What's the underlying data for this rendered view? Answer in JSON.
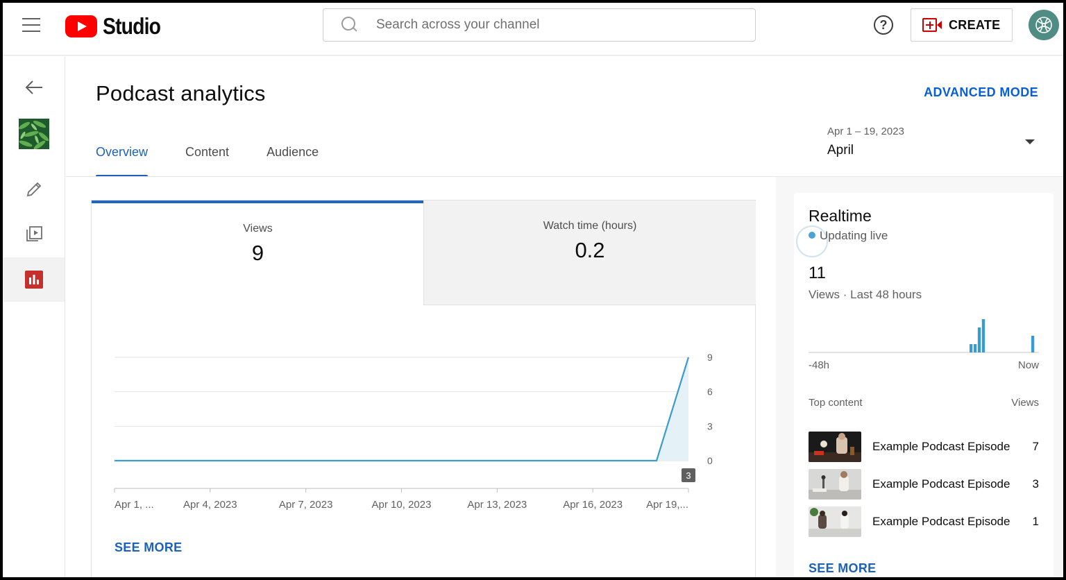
{
  "topbar": {
    "logo_text": "Studio",
    "search_placeholder": "Search across your channel",
    "help_glyph": "?",
    "create_label": "CREATE"
  },
  "icons": {
    "menu": "hamburger-menu-icon",
    "search": "search-icon",
    "help": "help-icon",
    "create": "video-camera-plus-icon",
    "back": "back-arrow-icon",
    "edit": "pencil-icon",
    "content": "video-library-icon",
    "analytics": "analytics-bar-chart-icon"
  },
  "page": {
    "title": "Podcast analytics",
    "advanced_mode": "ADVANCED MODE",
    "tabs": [
      {
        "label": "Overview",
        "active": true
      },
      {
        "label": "Content",
        "active": false
      },
      {
        "label": "Audience",
        "active": false
      }
    ],
    "date_range": "Apr 1 – 19, 2023",
    "date_label": "April"
  },
  "metrics": [
    {
      "label": "Views",
      "value": "9",
      "selected": true
    },
    {
      "label": "Watch time (hours)",
      "value": "0.2",
      "selected": false
    }
  ],
  "chart_data": {
    "type": "area",
    "x": [
      "Apr 1, 2023",
      "Apr 2, 2023",
      "Apr 3, 2023",
      "Apr 4, 2023",
      "Apr 5, 2023",
      "Apr 6, 2023",
      "Apr 7, 2023",
      "Apr 8, 2023",
      "Apr 9, 2023",
      "Apr 10, 2023",
      "Apr 11, 2023",
      "Apr 12, 2023",
      "Apr 13, 2023",
      "Apr 14, 2023",
      "Apr 15, 2023",
      "Apr 16, 2023",
      "Apr 17, 2023",
      "Apr 18, 2023",
      "Apr 19, 2023"
    ],
    "series": [
      {
        "values": [
          0,
          0,
          0,
          0,
          0,
          0,
          0,
          0,
          0,
          0,
          0,
          0,
          0,
          0,
          0,
          0,
          0,
          0,
          9
        ]
      }
    ],
    "x_tick_labels": [
      "Apr 1, ...",
      "Apr 4, 2023",
      "Apr 7, 2023",
      "Apr 10, 2023",
      "Apr 13, 2023",
      "Apr 16, 2023",
      "Apr 19,..."
    ],
    "y_ticks": [
      0,
      3,
      6,
      9
    ],
    "ylim": [
      0,
      9
    ],
    "grid": true,
    "marker_badge": "3",
    "color": "#3a9bd0"
  },
  "chart_see_more": "SEE MORE",
  "realtime": {
    "title": "Realtime",
    "status": "Updating live",
    "count": "11",
    "subtitle": "Views · Last 48 hours",
    "axis_start": "-48h",
    "axis_end": "Now",
    "bars_color": "#3a9bd0",
    "bars": [
      0,
      0,
      0,
      0,
      0,
      0,
      0,
      0,
      0,
      0,
      0,
      0,
      0,
      0,
      0,
      0,
      0,
      0,
      0,
      0,
      0,
      0,
      0,
      0,
      0,
      0,
      0,
      0,
      0,
      0,
      0,
      0,
      0,
      0,
      0,
      0,
      0,
      0,
      0,
      1,
      1,
      3,
      4,
      0,
      0,
      0,
      0,
      0,
      0,
      0,
      0,
      0,
      0,
      0,
      2,
      0
    ],
    "top_content_header": "Top content",
    "views_header": "Views",
    "items": [
      {
        "title": "Example Podcast Episode",
        "views": "7"
      },
      {
        "title": "Example Podcast Episode",
        "views": "3"
      },
      {
        "title": "Example Podcast Episode",
        "views": "1"
      }
    ],
    "see_more": "SEE MORE"
  }
}
